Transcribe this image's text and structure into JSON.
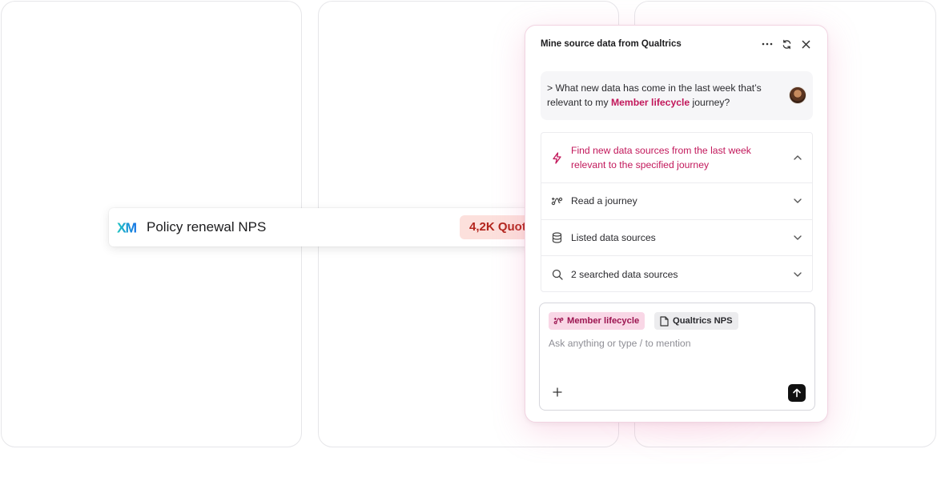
{
  "source_row": {
    "logo_text": "XM",
    "title": "Policy renewal NPS",
    "badge": "4,2K Quotes"
  },
  "panel": {
    "title": "Mine source data from Qualtrics",
    "header_icons": [
      "more-icon",
      "refresh-icon",
      "close-icon"
    ],
    "prompt": {
      "prefix": "> What new data has come in the last week that’s relevant to my ",
      "highlight": "Member lifecycle",
      "suffix": " journey?"
    },
    "steps": [
      {
        "label": "Find new data sources from the last week relevant to the specified journey",
        "icon": "lightning-icon",
        "expanded": true
      },
      {
        "label": "Read a journey",
        "icon": "journey-icon",
        "expanded": false
      },
      {
        "label": "Listed data sources",
        "icon": "database-icon",
        "expanded": false
      },
      {
        "label": "2 searched data sources",
        "icon": "search-icon",
        "expanded": false
      }
    ],
    "composer": {
      "chips": [
        {
          "label": "Member lifecycle",
          "icon": "journey-icon"
        },
        {
          "label": "Qualtrics NPS",
          "icon": "document-icon"
        }
      ],
      "placeholder": "Ask anything or type / to mention"
    }
  },
  "colors": {
    "accent": "#c2185b",
    "chip_journey_bg": "#f9d7e6",
    "badge_bg": "#fce0dc",
    "badge_text": "#b3261e",
    "xm_blue": "#1aa3e8"
  }
}
